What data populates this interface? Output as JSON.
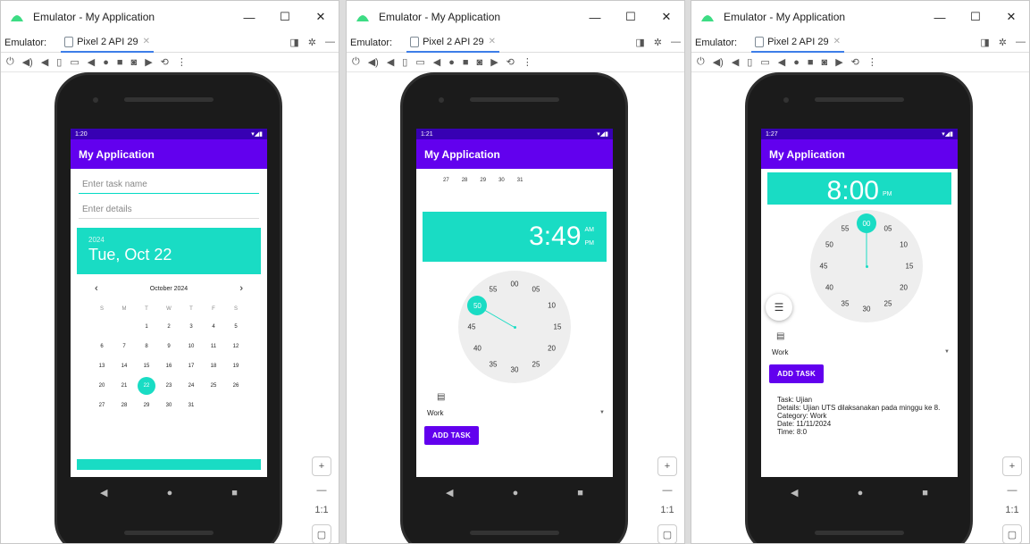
{
  "windows": [
    {
      "title": "Emulator - My Application",
      "emulator_label": "Emulator:",
      "device_tab": "Pixel 2 API 29",
      "status_time": "1:20",
      "app_title": "My Application",
      "task_placeholder": "Enter task name",
      "details_placeholder": "Enter details",
      "cal_year": "2024",
      "cal_date": "Tue, Oct 22",
      "cal_month": "October 2024",
      "dow": [
        "S",
        "M",
        "T",
        "W",
        "T",
        "F",
        "S"
      ],
      "days": [
        "",
        "",
        "1",
        "2",
        "3",
        "4",
        "5",
        "6",
        "7",
        "8",
        "9",
        "10",
        "11",
        "12",
        "13",
        "14",
        "15",
        "16",
        "17",
        "18",
        "19",
        "20",
        "21",
        "22",
        "23",
        "24",
        "25",
        "26",
        "27",
        "28",
        "29",
        "30",
        "31",
        "",
        "",
        ""
      ],
      "selected_day": "22"
    },
    {
      "title": "Emulator - My Application",
      "emulator_label": "Emulator:",
      "device_tab": "Pixel 2 API 29",
      "status_time": "1:21",
      "app_title": "My Application",
      "cal_tail": [
        "27",
        "28",
        "29",
        "30",
        "31"
      ],
      "time": "3:49",
      "am": "AM",
      "pm": "PM",
      "knob_label": "50",
      "clock_numbers": [
        "00",
        "05",
        "10",
        "15",
        "20",
        "25",
        "30",
        "35",
        "40",
        "45",
        "50",
        "55"
      ],
      "category": "Work",
      "add_task": "ADD TASK"
    },
    {
      "title": "Emulator - My Application",
      "emulator_label": "Emulator:",
      "device_tab": "Pixel 2 API 29",
      "status_time": "1:27",
      "app_title": "My Application",
      "time": "8:00",
      "pm": "PM",
      "knob_label": "00",
      "clock_numbers": [
        "00",
        "05",
        "10",
        "15",
        "20",
        "25",
        "30",
        "35",
        "40",
        "45",
        "50",
        "55"
      ],
      "category": "Work",
      "add_task": "ADD TASK",
      "output": {
        "task": "Task: Ujian",
        "details": "Details: Ujian UTS dilaksanakan pada minggu ke 8.",
        "category": "Category: Work",
        "date": "Date: 11/11/2024",
        "time": "Time: 8:0"
      }
    }
  ],
  "zoom": {
    "plus": "+",
    "minus": "—",
    "ratio": "1:1"
  },
  "colors": {
    "primary": "#6200ee",
    "status": "#3700b3",
    "accent": "#19dcc4"
  }
}
